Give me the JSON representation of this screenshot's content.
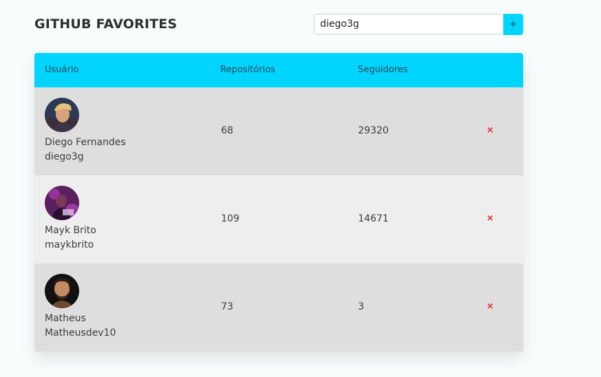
{
  "header": {
    "title": "GITHUB FAVORITES"
  },
  "search": {
    "value": "diego3g",
    "add_label": "+"
  },
  "table": {
    "columns": [
      "Usuário",
      "Repositórios",
      "Seguidores"
    ],
    "rows": [
      {
        "name": "Diego Fernandes",
        "login": "diego3g",
        "repos": "68",
        "followers": "29320",
        "remove_label": "×"
      },
      {
        "name": "Mayk Brito",
        "login": "maykbrito",
        "repos": "109",
        "followers": "14671",
        "remove_label": "×"
      },
      {
        "name": "Matheus",
        "login": "Matheusdev10",
        "repos": "73",
        "followers": "3",
        "remove_label": "×"
      }
    ]
  },
  "colors": {
    "accent": "#00d4ff",
    "remove": "#e0262b",
    "row_odd": "#dedede",
    "row_even": "#eeeeee",
    "background": "#f7fcfd"
  }
}
